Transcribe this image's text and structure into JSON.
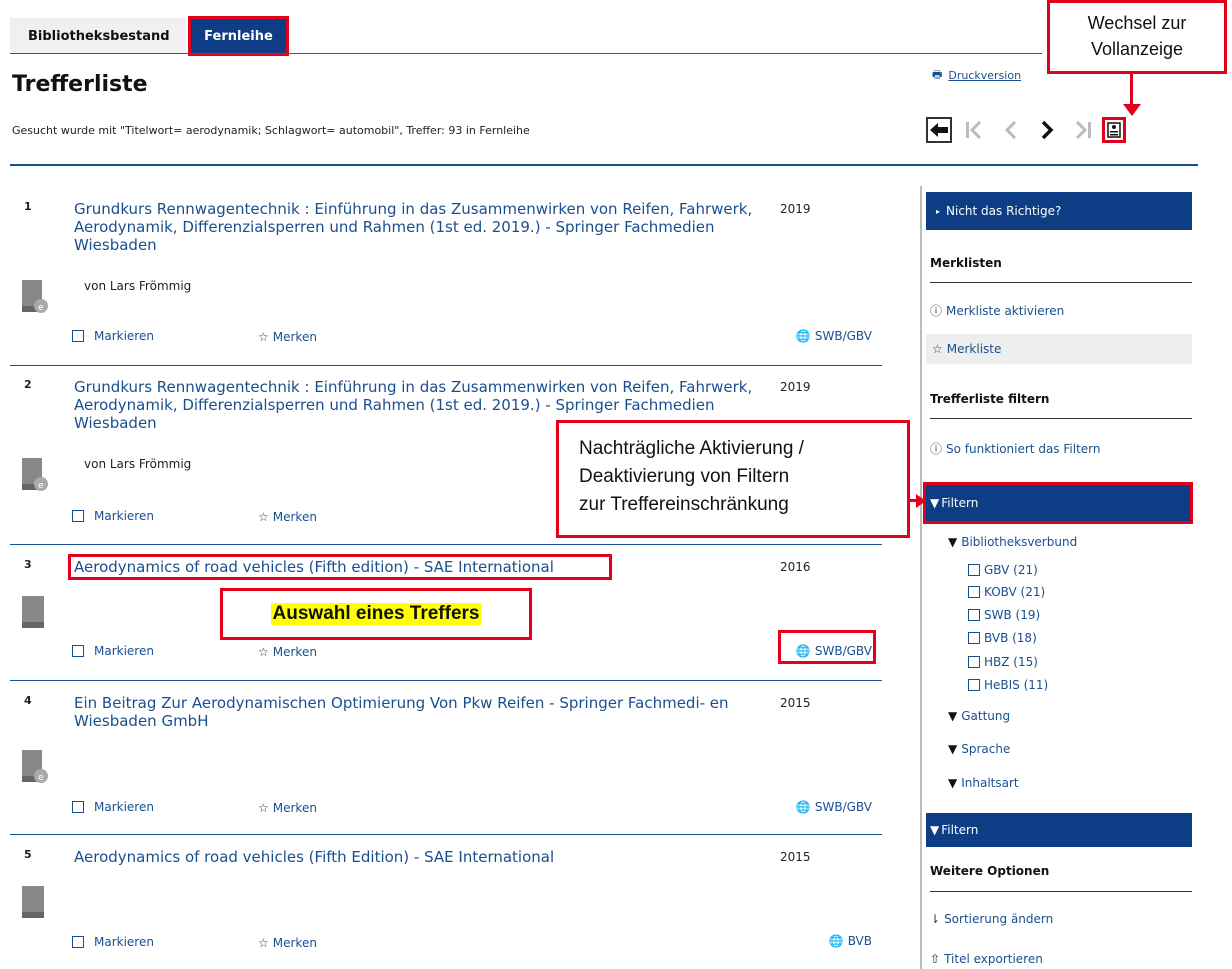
{
  "tabs": {
    "bestand": "Bibliotheksbestand",
    "fernleihe": "Fernleihe"
  },
  "page_title": "Trefferliste",
  "search_info": "Gesucht wurde mit \"Titelwort= aerodynamik; Schlagwort= automobil\", Treffer: 93 in Fernleihe",
  "print_link": "Druckversion",
  "callouts": {
    "full_view_line1": "Wechsel zur",
    "full_view_line2": "Vollanzeige",
    "filter_line1": "Nachträgliche Aktivierung /",
    "filter_line2": "Deaktivierung von Filtern",
    "filter_line3": "zur Treffereinschränkung",
    "select": "Auswahl eines Treffers"
  },
  "actions": {
    "mark": "Markieren",
    "remember": "Merken"
  },
  "results": [
    {
      "num": "1",
      "title": "Grundkurs Rennwagentechnik : Einführung in das Zusammenwirken von Reifen, Fahrwerk, Aerodynamik, Differenzialsperren und Rahmen (1st ed. 2019.) - Springer Fachmedien Wiesbaden",
      "year": "2019",
      "author": "von Lars Frömmig",
      "source": "SWB/GBV",
      "icon": "ebook-icon"
    },
    {
      "num": "2",
      "title": "Grundkurs Rennwagentechnik : Einführung in das Zusammenwirken von Reifen, Fahrwerk, Aerodynamik, Differenzialsperren und Rahmen (1st ed. 2019.) - Springer Fachmedien Wiesbaden",
      "year": "2019",
      "author": "von Lars Frömmig",
      "source": "",
      "icon": "ebook-icon"
    },
    {
      "num": "3",
      "title": "Aerodynamics of road vehicles (Fifth edition) - SAE International",
      "year": "2016",
      "author": "",
      "source": "SWB/GBV",
      "icon": "book-icon"
    },
    {
      "num": "4",
      "title": "Ein Beitrag Zur Aerodynamischen Optimierung Von Pkw Reifen - Springer Fachmedi- en Wiesbaden GmbH",
      "year": "2015",
      "author": "",
      "source": "SWB/GBV",
      "icon": "ebook-icon"
    },
    {
      "num": "5",
      "title": "Aerodynamics of road vehicles (Fifth Edition) - SAE International",
      "year": "2015",
      "author": "",
      "source": "BVB",
      "icon": "book-icon"
    }
  ],
  "sidebar": {
    "not_right": "Nicht das Richtige?",
    "merklisten_head": "Merklisten",
    "activate": "Merkliste aktivieren",
    "merkliste": "Merkliste",
    "filter_head": "Trefferliste filtern",
    "how_filter": "So funktioniert das Filtern",
    "filter_bar": "Filtern",
    "verbund": "Bibliotheksverbund",
    "verbund_options": [
      "GBV (21)",
      "KOBV (21)",
      "SWB (19)",
      "BVB (18)",
      "HBZ (15)",
      "HeBIS (11)"
    ],
    "gattung": "Gattung",
    "sprache": "Sprache",
    "inhaltsart": "Inhaltsart",
    "filter_bar2": "Filtern",
    "more_options": "Weitere Optionen",
    "sort": "Sortierung ändern",
    "export": "Titel exportieren"
  },
  "colors": {
    "brand": "#0e3c85",
    "link": "#1a4f8f",
    "highlight": "#e2001a",
    "marker": "#ffff00"
  }
}
